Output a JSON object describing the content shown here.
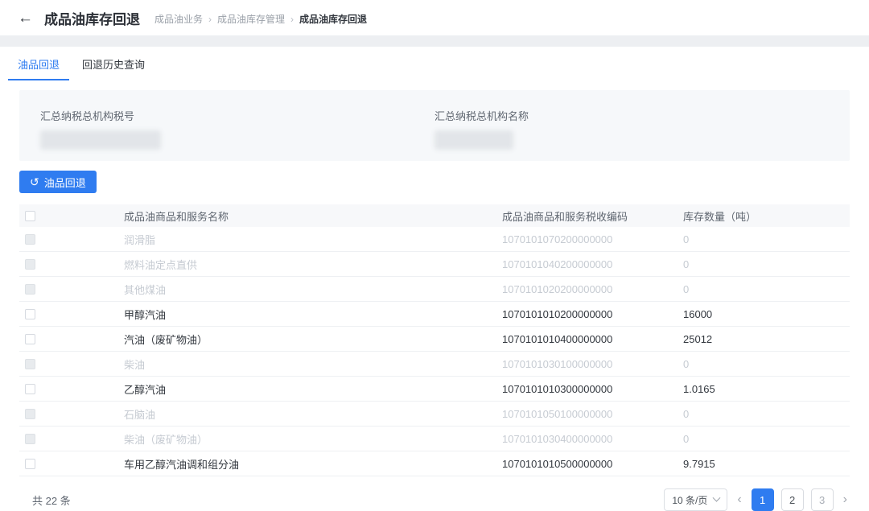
{
  "accent_color": "#2f7cf0",
  "header": {
    "back_icon": "←",
    "title": "成品油库存回退",
    "breadcrumb_separator": "›",
    "breadcrumb": [
      {
        "label": "成品油业务"
      },
      {
        "label": "成品油库存管理"
      },
      {
        "label": "成品油库存回退"
      }
    ]
  },
  "tabs": [
    {
      "label": "油品回退",
      "active": true
    },
    {
      "label": "回退历史查询",
      "active": false
    }
  ],
  "form": {
    "fields": [
      {
        "label": "汇总纳税总机构税号",
        "value_redacted": true
      },
      {
        "label": "汇总纳税总机构名称",
        "value_redacted": true
      }
    ]
  },
  "toolbar": {
    "rollback_button": {
      "icon": "↺",
      "label": "油品回退"
    }
  },
  "table": {
    "columns": [
      "成品油商品和服务名称",
      "成品油商品和服务税收编码",
      "库存数量（吨）"
    ],
    "rows": [
      {
        "name": "润滑脂",
        "code": "1070101070200000000",
        "qty": "0",
        "disabled": true
      },
      {
        "name": "燃料油定点直供",
        "code": "1070101040200000000",
        "qty": "0",
        "disabled": true
      },
      {
        "name": "其他煤油",
        "code": "1070101020200000000",
        "qty": "0",
        "disabled": true
      },
      {
        "name": "甲醇汽油",
        "code": "1070101010200000000",
        "qty": "16000",
        "disabled": false
      },
      {
        "name": "汽油（废矿物油）",
        "code": "1070101010400000000",
        "qty": "25012",
        "disabled": false
      },
      {
        "name": "柴油",
        "code": "1070101030100000000",
        "qty": "0",
        "disabled": true
      },
      {
        "name": "乙醇汽油",
        "code": "1070101010300000000",
        "qty": "1.0165",
        "disabled": false
      },
      {
        "name": "石脑油",
        "code": "1070101050100000000",
        "qty": "0",
        "disabled": true
      },
      {
        "name": "柴油（废矿物油）",
        "code": "1070101030400000000",
        "qty": "0",
        "disabled": true
      },
      {
        "name": "车用乙醇汽油调和组分油",
        "code": "1070101010500000000",
        "qty": "9.7915",
        "disabled": false
      }
    ]
  },
  "footer": {
    "total_text": "共 22 条",
    "page_size_label": "10 条/页",
    "prev_icon": "‹",
    "next_icon": "›",
    "pages": [
      "1",
      "2",
      "3"
    ],
    "active_page": "1"
  }
}
